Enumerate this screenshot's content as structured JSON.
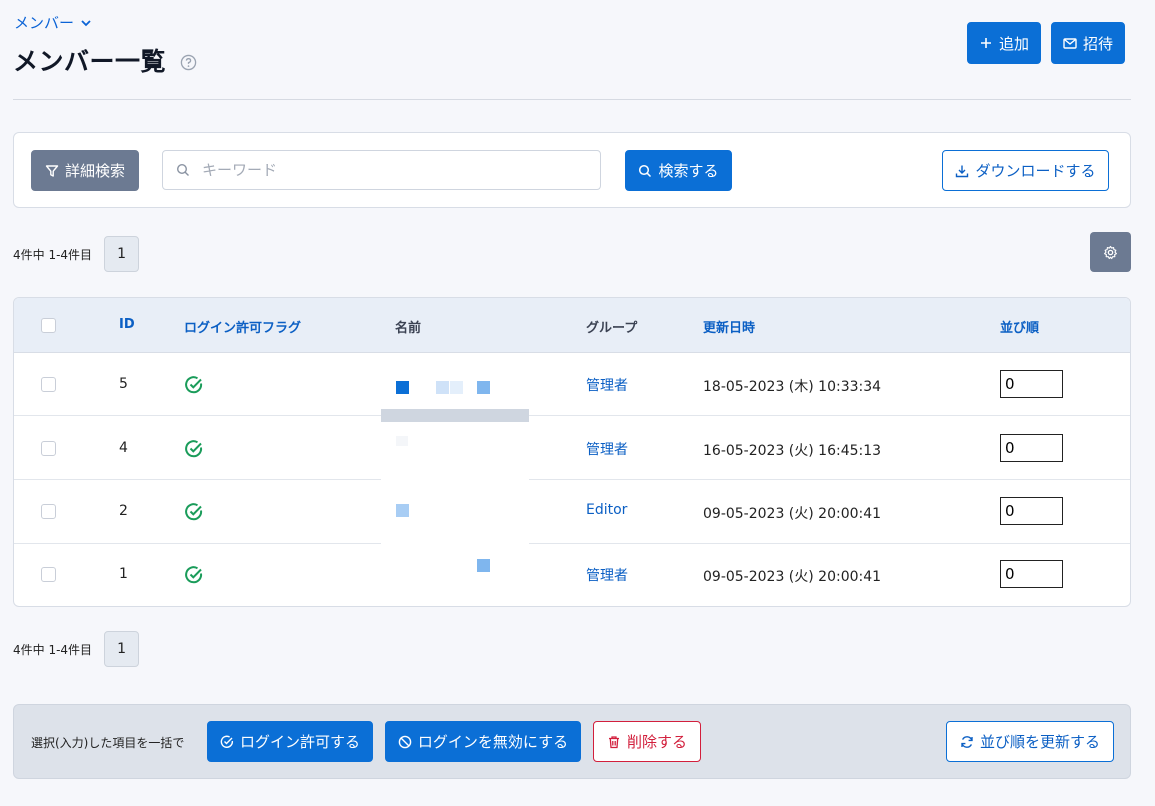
{
  "breadcrumb": {
    "label": "メンバー"
  },
  "header": {
    "title": "メンバー一覧",
    "add_label": "追加",
    "invite_label": "招待"
  },
  "search": {
    "advanced_label": "詳細検索",
    "keyword_placeholder": "キーワード",
    "keyword_value": "",
    "search_label": "検索する",
    "download_label": "ダウンロードする"
  },
  "pagination": {
    "summary": "4件中 1-4件目",
    "current_page": "1"
  },
  "table": {
    "columns": {
      "id": "ID",
      "login_flag": "ログイン許可フラグ",
      "name": "名前",
      "group": "グループ",
      "updated_at": "更新日時",
      "order": "並び順"
    },
    "rows": [
      {
        "id": "5",
        "login_allowed": true,
        "group": "管理者",
        "updated_at": "18-05-2023 (木) 10:33:34",
        "order": "0"
      },
      {
        "id": "4",
        "login_allowed": true,
        "group": "管理者",
        "updated_at": "16-05-2023 (火) 16:45:13",
        "order": "0"
      },
      {
        "id": "2",
        "login_allowed": true,
        "group": "Editor",
        "updated_at": "09-05-2023 (火) 20:00:41",
        "order": "0"
      },
      {
        "id": "1",
        "login_allowed": true,
        "group": "管理者",
        "updated_at": "09-05-2023 (火) 20:00:41",
        "order": "0"
      }
    ]
  },
  "bulk": {
    "label": "選択(入力)した項目を一括で",
    "allow_login_label": "ログイン許可する",
    "disable_login_label": "ログインを無効にする",
    "delete_label": "削除する",
    "update_order_label": "並び順を更新する"
  },
  "colors": {
    "primary": "#0b6fd6",
    "danger": "#d21f3c",
    "gray_button": "#6c7a92",
    "success_icon": "#1a9c5a"
  },
  "icons": {
    "breadcrumb": "chevron-down-icon",
    "title": "help-circle-icon",
    "add": "plus-icon",
    "invite": "mail-icon",
    "advanced": "filter-icon",
    "keyword": "search-icon",
    "search": "search-icon",
    "download": "download-icon",
    "settings": "gear-icon",
    "login_flag": "check-circle-icon",
    "allow": "check-circle-icon",
    "disable": "ban-icon",
    "delete": "trash-icon",
    "update_order": "refresh-icon"
  }
}
